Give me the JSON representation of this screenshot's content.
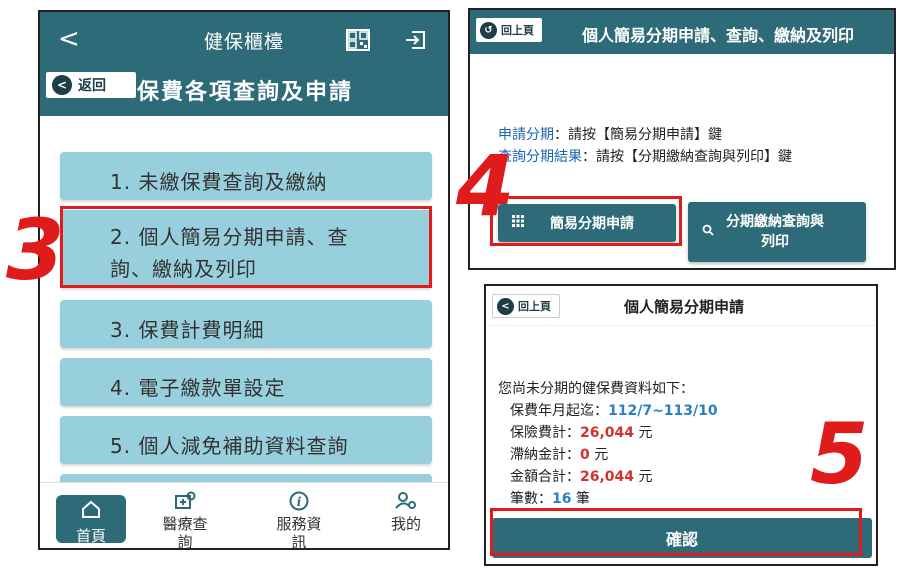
{
  "panel1": {
    "header": {
      "back": "<",
      "title": "健保櫃檯",
      "qr_icon": "qr-code-icon",
      "exit_icon": "logout-icon"
    },
    "return_button": "返回",
    "page_title": "保費各項查詢及申請",
    "menu": [
      {
        "label": "1. 未繳保費查詢及繳納"
      },
      {
        "label_line1": "2. 個人簡易分期申請、查",
        "label_line2": "詢、繳納及列印"
      },
      {
        "label": "3. 保費計費明細"
      },
      {
        "label": "4. 電子繳款單設定"
      },
      {
        "label": "5. 個人減免補助資料查詢"
      }
    ],
    "bottom_nav": [
      {
        "label": "首頁",
        "icon": "home-icon"
      },
      {
        "label_line1": "醫療查",
        "label_line2": "詢",
        "icon": "medical-search-icon"
      },
      {
        "label_line1": "服務資",
        "label_line2": "訊",
        "icon": "info-icon"
      },
      {
        "label": "我的",
        "icon": "user-settings-icon"
      }
    ]
  },
  "steps": {
    "s3": "3",
    "s4": "4",
    "s5": "5"
  },
  "panel2": {
    "return_button": "回上頁",
    "title": "個人簡易分期申請、查詢、繳納及列印",
    "instr1_hl": "申請分期",
    "instr1_rest": "：請按【簡易分期申請】鍵",
    "instr2_hl": "查詢分期結果",
    "instr2_rest": "：請按【分期繳納查詢與列印】鍵",
    "btn_apply": "簡易分期申請",
    "btn_query_line1": "分期繳納查詢與",
    "btn_query_line2": "列印"
  },
  "panel3": {
    "return_button": "回上頁",
    "title": "個人簡易分期申請",
    "intro": "您尚未分期的健保費資料如下：",
    "period_label": "保費年月起迄：",
    "period_value": "112/7~113/10",
    "premium_label": "保險費計：",
    "premium_value": "26,044",
    "premium_unit": " 元",
    "late_label": "滯納金計：",
    "late_value": "0",
    "late_unit": " 元",
    "total_label": "金額合計：",
    "total_value": "26,044",
    "total_unit": " 元",
    "count_label": "筆數：",
    "count_value": "16",
    "count_unit": " 筆",
    "confirm": "確認"
  },
  "colors": {
    "teal": "#2e6b78",
    "menu": "#98cfdc",
    "highlight": "#e01b1b",
    "link": "#1a63b3"
  }
}
